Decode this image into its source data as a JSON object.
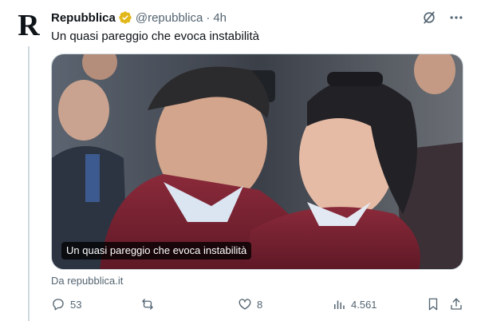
{
  "account": {
    "avatar_letter": "R",
    "display_name": "Repubblica",
    "handle": "@repubblica",
    "separator": "·",
    "time": "4h",
    "verified_color": "#e2b719"
  },
  "tweet": {
    "text": "Un quasi pareggio che evoca instabilità"
  },
  "media": {
    "caption": "Un quasi pareggio che evoca instabilità",
    "source": "Da repubblica.it"
  },
  "actions": {
    "replies": "53",
    "retweets": "",
    "likes": "8",
    "views": "4.561"
  },
  "icons": {
    "grok": "grok-icon",
    "more": "more-icon",
    "reply": "reply-icon",
    "retweet": "retweet-icon",
    "like": "like-icon",
    "views": "views-icon",
    "bookmark": "bookmark-icon",
    "share": "share-icon"
  },
  "colors": {
    "text_primary": "#0f1419",
    "text_secondary": "#536471",
    "border": "#cfd9de"
  }
}
